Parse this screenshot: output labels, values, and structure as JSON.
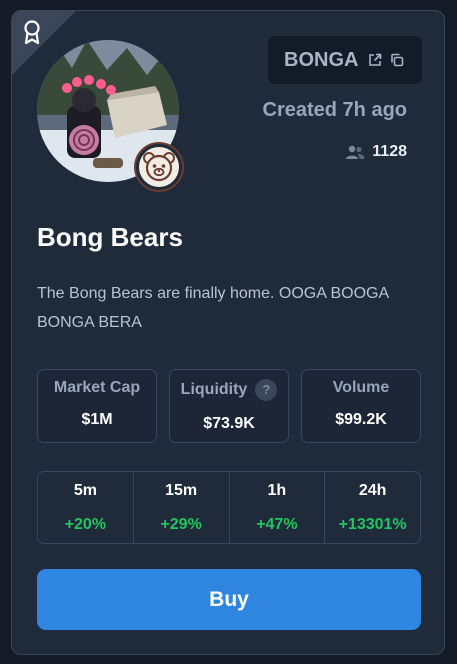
{
  "token": {
    "ticker": "BONGA",
    "name": "Bong Bears",
    "created": "Created 7h ago",
    "holders": "1128",
    "description": "The Bong Bears are finally home. OOGA BOOGA BONGA BERA"
  },
  "stats": [
    {
      "label": "Market Cap",
      "value": "$1M"
    },
    {
      "label": "Liquidity",
      "value": "$73.9K",
      "help": "?"
    },
    {
      "label": "Volume",
      "value": "$99.2K"
    }
  ],
  "changes": [
    {
      "period": "5m",
      "pct": "+20%"
    },
    {
      "period": "15m",
      "pct": "+29%"
    },
    {
      "period": "1h",
      "pct": "+47%"
    },
    {
      "period": "24h",
      "pct": "+13301%"
    }
  ],
  "buy_label": "Buy",
  "icons": {
    "corner": "award-ribbon-icon",
    "external": "external-link-icon",
    "copy": "copy-icon",
    "holders": "users-icon",
    "badge": "bear-face-icon"
  },
  "colors": {
    "card_bg": "#1f2a3b",
    "accent": "#2f86e0",
    "positive": "#22c55e"
  }
}
